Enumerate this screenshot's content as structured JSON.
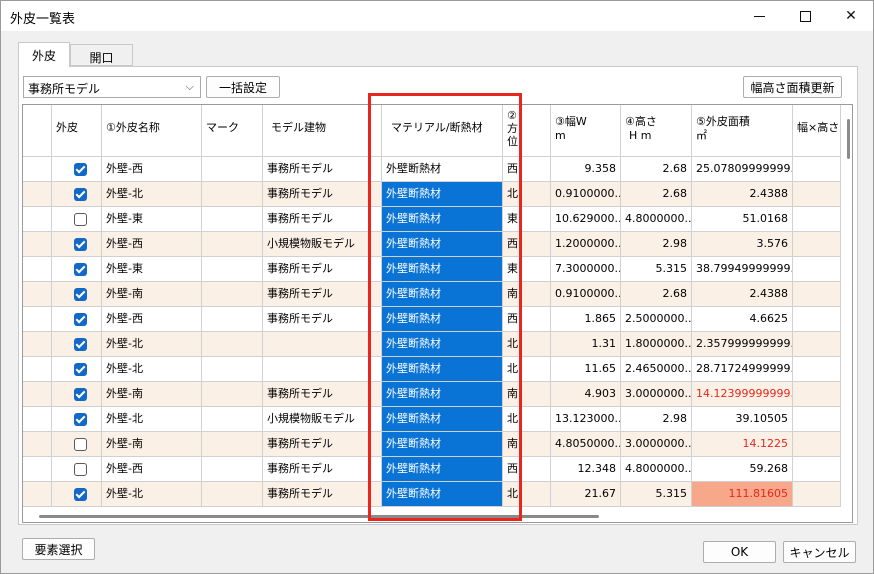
{
  "window": {
    "title": "外皮一覧表"
  },
  "tabs": [
    {
      "label": "外皮"
    },
    {
      "label": "開口"
    }
  ],
  "toolbar": {
    "model_select": "事務所モデル",
    "bulk_label": "一括設定",
    "update_label": "幅高さ面積更新"
  },
  "columns": {
    "gaihi": "外皮",
    "name": "①外皮名称",
    "mark": "マーク",
    "model": "モデル建物",
    "material": "マテリアル/断熱材",
    "dir1": "②",
    "dir2": "方",
    "dir3": "位",
    "width1": "③幅W",
    "width2": "m",
    "height1": "④高さ",
    "height2": "H m",
    "area1": "⑤外皮面積",
    "area2": "㎡",
    "wh": "幅×高さ"
  },
  "rows": [
    {
      "checked": true,
      "name": "外壁-西",
      "mark": "",
      "model": "事務所モデル",
      "material": "外壁断熱材",
      "dir": "西",
      "width": "9.358",
      "height": "2.68",
      "area": "25.07809999999..."
    },
    {
      "checked": true,
      "name": "外壁-北",
      "mark": "",
      "model": "事務所モデル",
      "material": "外壁断熱材",
      "dir": "北",
      "width": "0.9100000...",
      "height": "2.68",
      "area": "2.4388"
    },
    {
      "checked": false,
      "name": "外壁-東",
      "mark": "",
      "model": "事務所モデル",
      "material": "外壁断熱材",
      "dir": "東",
      "width": "10.629000...",
      "height": "4.8000000...",
      "area": "51.0168"
    },
    {
      "checked": true,
      "name": "外壁-西",
      "mark": "",
      "model": "小規模物販モデル",
      "material": "外壁断熱材",
      "dir": "西",
      "width": "1.2000000...",
      "height": "2.98",
      "area": "3.576"
    },
    {
      "checked": true,
      "name": "外壁-東",
      "mark": "",
      "model": "事務所モデル",
      "material": "外壁断熱材",
      "dir": "東",
      "width": "7.3000000...",
      "height": "5.315",
      "area": "38.79949999999..."
    },
    {
      "checked": true,
      "name": "外壁-南",
      "mark": "",
      "model": "事務所モデル",
      "material": "外壁断熱材",
      "dir": "南",
      "width": "0.9100000...",
      "height": "2.68",
      "area": "2.4388"
    },
    {
      "checked": true,
      "name": "外壁-西",
      "mark": "",
      "model": "事務所モデル",
      "material": "外壁断熱材",
      "dir": "西",
      "width": "1.865",
      "height": "2.5000000...",
      "area": "4.6625"
    },
    {
      "checked": true,
      "name": "外壁-北",
      "mark": "",
      "model": "",
      "material": "外壁断熱材",
      "dir": "北",
      "width": "1.31",
      "height": "1.8000000...",
      "area": "2.357999999999..."
    },
    {
      "checked": true,
      "name": "外壁-北",
      "mark": "",
      "model": "",
      "material": "外壁断熱材",
      "dir": "北",
      "width": "11.65",
      "height": "2.4650000...",
      "area": "28.71724999999..."
    },
    {
      "checked": true,
      "name": "外壁-南",
      "mark": "",
      "model": "事務所モデル",
      "material": "外壁断熱材",
      "dir": "南",
      "width": "4.903",
      "height": "3.0000000...",
      "area": "14.12399999999..."
    },
    {
      "checked": true,
      "name": "外壁-北",
      "mark": "",
      "model": "小規模物販モデル",
      "material": "外壁断熱材",
      "dir": "北",
      "width": "13.123000...",
      "height": "2.98",
      "area": "39.10505"
    },
    {
      "checked": false,
      "name": "外壁-南",
      "mark": "",
      "model": "事務所モデル",
      "material": "外壁断熱材",
      "dir": "南",
      "width": "4.8050000...",
      "height": "3.0000000...",
      "area": "14.1225"
    },
    {
      "checked": false,
      "name": "外壁-西",
      "mark": "",
      "model": "事務所モデル",
      "material": "外壁断熱材",
      "dir": "西",
      "width": "12.348",
      "height": "4.8000000...",
      "area": "59.268"
    },
    {
      "checked": true,
      "name": "外壁-北",
      "mark": "",
      "model": "事務所モデル",
      "material": "外壁断熱材",
      "dir": "北",
      "width": "21.67",
      "height": "5.315",
      "area": "111.81605"
    }
  ],
  "footer": {
    "select_elements": "要素選択",
    "ok": "OK",
    "cancel": "キャンセル"
  },
  "colors": {
    "selection": "#0a74d6",
    "alt_row": "#fbf0e6",
    "warning_text": "#e8261e",
    "highlight_cell": "#f8a88a",
    "annotation_box": "#e8261e"
  }
}
